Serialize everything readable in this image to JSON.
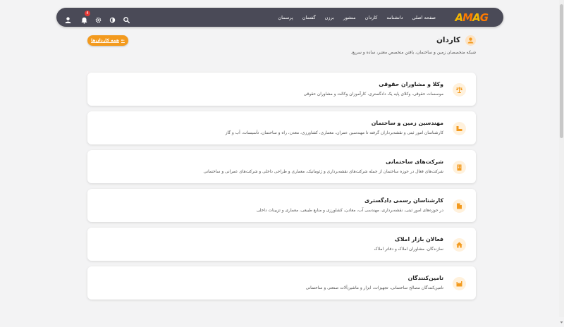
{
  "header": {
    "logo_text": "AMAG",
    "notification_count": "4",
    "menu": [
      {
        "label": "صفحه اصلی"
      },
      {
        "label": "دانشنامه"
      },
      {
        "label": "کاردان"
      },
      {
        "label": "منشور"
      },
      {
        "label": "برزن"
      },
      {
        "label": "گفتمان"
      },
      {
        "label": "پرسمان"
      }
    ],
    "icons": [
      "user-icon",
      "bell-icon",
      "settings-icon",
      "theme-icon",
      "search-icon"
    ]
  },
  "page": {
    "title": "کاردان",
    "subtitle": "شبکه متخصصان زمین و ساختمان، یافتن متخصص معتبر، ساده و سریع.",
    "all_button_label": "همه کاردان‌ها",
    "all_button_arrow": "←"
  },
  "categories": [
    {
      "title": "وکلا و مشاوران حقوقی",
      "description": "موسسات حقوقی، وکلای پایه یک دادگستری، کارآموزان وکالت و مشاوران حقوقی",
      "icon": "scale-icon"
    },
    {
      "title": "مهندسین زمین و ساختمان",
      "description": "کارشناسان امور ثبتی و نقشه‌برداران گرفته تا مهندسین عمران، معماری، کشاورزی، معدن، راه و ساختمان، تأسیسات، آب و گاز",
      "icon": "engineer-icon"
    },
    {
      "title": "شرکت‌های ساختمانی",
      "description": "شرکت‌های فعال در حوزه ساختمان از جمله شرکت‌های نقشه‌برداری و ژئوماتیک، معماری و طراحی داخلی و شرکت‌های عمرانی و ساختمانی",
      "icon": "building-icon"
    },
    {
      "title": "کارشناسان رسمی دادگستری",
      "description": "در حوزه‌های امور ثبتی، نقشه‌برداری، مهندسی آب، معادن، کشاورزی و منابع طبیعی، معماری و تزیینات داخلی",
      "icon": "document-icon"
    },
    {
      "title": "فعالان بازار املاک",
      "description": "سازندگان، مشاوران املاک و دفاتر املاک",
      "icon": "home-icon"
    },
    {
      "title": "تامین‌کنندگان",
      "description": "تامین‌کنندگان مصالح ساختمانی، تجهیزات، ابزار و ماشین‌آلات صنعتی و ساختمانی",
      "icon": "factory-icon"
    }
  ],
  "colors": {
    "accent": "#f39a1e",
    "navbar": "#4a4a57",
    "background": "#f3f3f4",
    "badge": "#e53935"
  }
}
